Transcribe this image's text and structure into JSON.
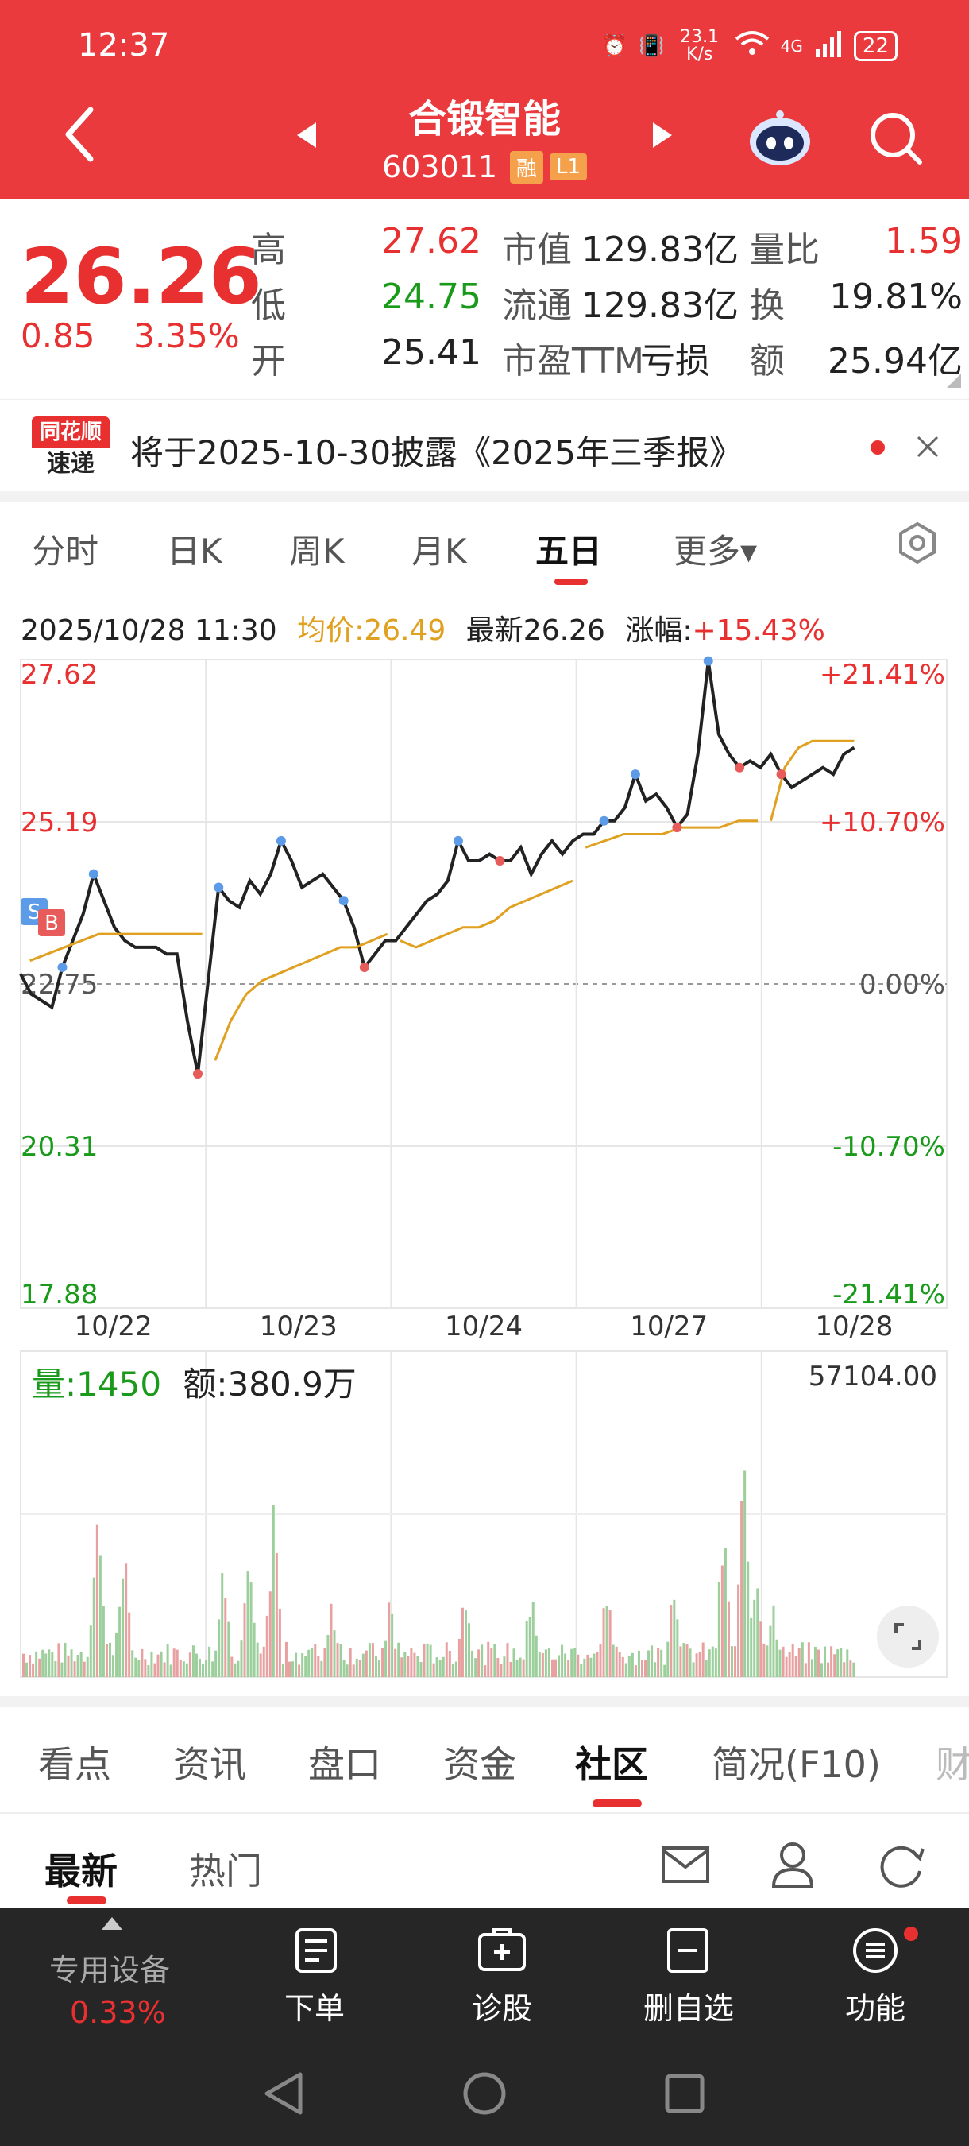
{
  "status": {
    "time": "12:37",
    "net_speed": "23.1 K/s",
    "signal": "4G",
    "battery": "22"
  },
  "header": {
    "title": "合锻智能",
    "code": "603011",
    "tag_margin": "融",
    "tag_level": "L1"
  },
  "quote": {
    "price": "26.26",
    "change": "0.85",
    "change_pct": "3.35%",
    "rows": [
      {
        "l1": "高",
        "v1": "27.62",
        "l2": "市值",
        "v2": "129.83亿",
        "l3": "量比",
        "v3": "1.59"
      },
      {
        "l1": "低",
        "v1": "24.75",
        "l2": "流通",
        "v2": "129.83亿",
        "l3": "换",
        "v3": "19.81%"
      },
      {
        "l1": "开",
        "v1": "25.41",
        "l2": "市盈TTM",
        "v2": "亏损",
        "l3": "额",
        "v3": "25.94亿"
      }
    ]
  },
  "notice": {
    "logo_top": "同花顺",
    "logo_bottom": "速递",
    "text": "将于2025-10-30披露《2025年三季报》"
  },
  "period_tabs": [
    "分时",
    "日K",
    "周K",
    "月K",
    "五日",
    "更多▾"
  ],
  "active_period": "五日",
  "chart_info": {
    "datetime": "2025/10/28 11:30",
    "avg": "均价:26.49",
    "latest": "最新26.26",
    "change_label": "涨幅:",
    "change_value": "+15.43%"
  },
  "chart_data": {
    "type": "line",
    "y_left_ticks": [
      "27.62",
      "25.19",
      "22.75",
      "20.31",
      "17.88"
    ],
    "y_right_ticks": [
      "+21.41%",
      "+10.70%",
      "0.00%",
      "-10.70%",
      "-21.41%"
    ],
    "x_ticks": [
      "10/22",
      "10/23",
      "10/24",
      "10/27",
      "10/28"
    ],
    "ylim": [
      17.88,
      27.62
    ],
    "prev_close": 22.75,
    "series": [
      {
        "values": [
          22.9,
          22.6,
          22.5,
          22.4,
          23.0,
          23.4,
          23.8,
          24.4,
          24.0,
          23.6,
          23.4,
          23.3,
          23.3,
          23.3,
          23.2,
          23.2,
          22.2,
          21.4,
          22.8,
          24.2,
          24.0,
          23.9,
          24.3,
          24.1,
          24.4,
          24.9,
          24.6,
          24.2,
          24.3,
          24.4,
          24.2,
          24.0,
          23.6,
          23.0,
          23.2,
          23.4,
          23.4,
          23.6,
          23.8,
          24.0,
          24.1,
          24.3,
          24.9,
          24.6,
          24.6,
          24.7,
          24.6,
          24.6,
          24.8,
          24.4,
          24.7,
          24.9,
          24.7,
          24.9,
          25.0,
          25.0,
          25.2,
          25.2,
          25.4,
          25.9,
          25.5,
          25.6,
          25.4,
          25.1,
          25.3,
          26.2,
          27.6,
          26.5,
          26.2,
          26.0,
          26.1,
          26.0,
          26.2,
          25.9,
          25.7,
          25.8,
          25.9,
          26.0,
          25.9,
          26.2,
          26.3
        ]
      },
      {
        "values": [
          23.1,
          23.3,
          23.5,
          23.5,
          23.5,
          23.5,
          21.6,
          22.2,
          22.6,
          22.8,
          22.9,
          23.0,
          23.1,
          23.2,
          23.3,
          23.3,
          23.4,
          23.5,
          23.4,
          23.3,
          23.4,
          23.5,
          23.6,
          23.6,
          23.7,
          23.9,
          24.0,
          24.1,
          24.2,
          24.3,
          24.8,
          24.9,
          25.0,
          25.0,
          25.0,
          25.1,
          25.1,
          25.1,
          25.2,
          25.2,
          25.2,
          26.0,
          26.3,
          26.4,
          26.4,
          26.4,
          26.4
        ]
      }
    ]
  },
  "volume": {
    "label": "量:1450",
    "amount": "额:380.9万",
    "max": "57104.00"
  },
  "content_tabs": [
    "看点",
    "资讯",
    "盘口",
    "资金",
    "社区",
    "简况(F10)",
    "财"
  ],
  "active_content_tab": "社区",
  "sub_tabs": [
    "最新",
    "热门"
  ],
  "active_sub_tab": "最新",
  "bottom_bar": {
    "device_label": "专用设备",
    "device_pct": "0.33%",
    "items": [
      "下单",
      "诊股",
      "删自选",
      "功能"
    ]
  },
  "colors": {
    "up": "#e93030",
    "down": "#1a9a1a",
    "avg_line": "#e0a020",
    "header": "#ea3a3e"
  }
}
